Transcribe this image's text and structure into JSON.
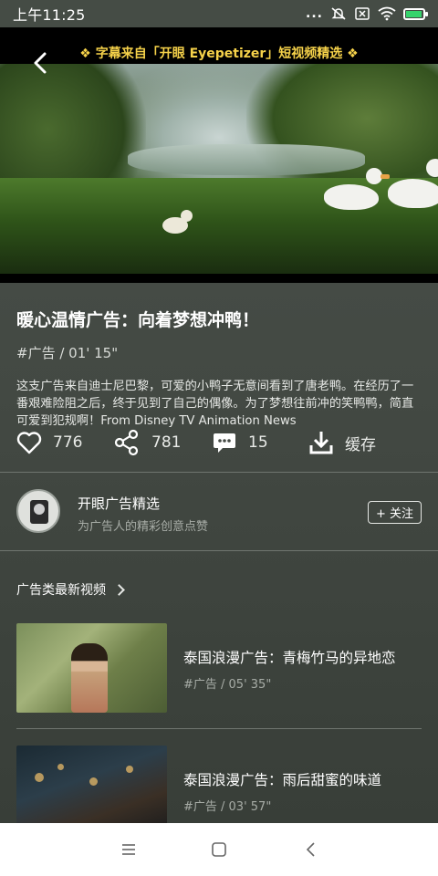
{
  "status_bar": {
    "time": "上午11:25",
    "dots": "...",
    "icons": [
      "mute-icon",
      "sim-icon",
      "wifi-icon",
      "battery-charging-icon"
    ],
    "battery_fill": 0.85,
    "battery_color": "#36d36c"
  },
  "video": {
    "caption": "❖ 字幕来自「开眼 Eyepetizer」短视频精选 ❖",
    "caption_color": "#f6d24a"
  },
  "detail": {
    "title": "暖心温情广告：向着梦想冲鸭！",
    "meta": "#广告 / 01' 15\"",
    "description": "这支广告来自迪士尼巴黎，可爱的小鸭子无意间看到了唐老鸭。在经历了一番艰难险阻之后，终于见到了自己的偶像。为了梦想往前冲的笑鸭鸭，简直可爱到犯规啊！From Disney TV Animation News"
  },
  "actions": {
    "likes": "776",
    "shares": "781",
    "comments": "15",
    "download_label": "缓存"
  },
  "author": {
    "name": "开眼广告精选",
    "subtitle": "为广告人的精彩创意点赞",
    "follow_label": "+ 关注"
  },
  "related": {
    "section_title": "广告类最新视频",
    "items": [
      {
        "title": "泰国浪漫广告：青梅竹马的异地恋",
        "meta": "#广告 / 05' 35\""
      },
      {
        "title": "泰国浪漫广告：雨后甜蜜的味道",
        "meta": "#广告 / 03' 57\""
      }
    ]
  },
  "navbar": {
    "icons": [
      "menu-icon",
      "home-square-icon",
      "back-chevron-icon"
    ]
  }
}
